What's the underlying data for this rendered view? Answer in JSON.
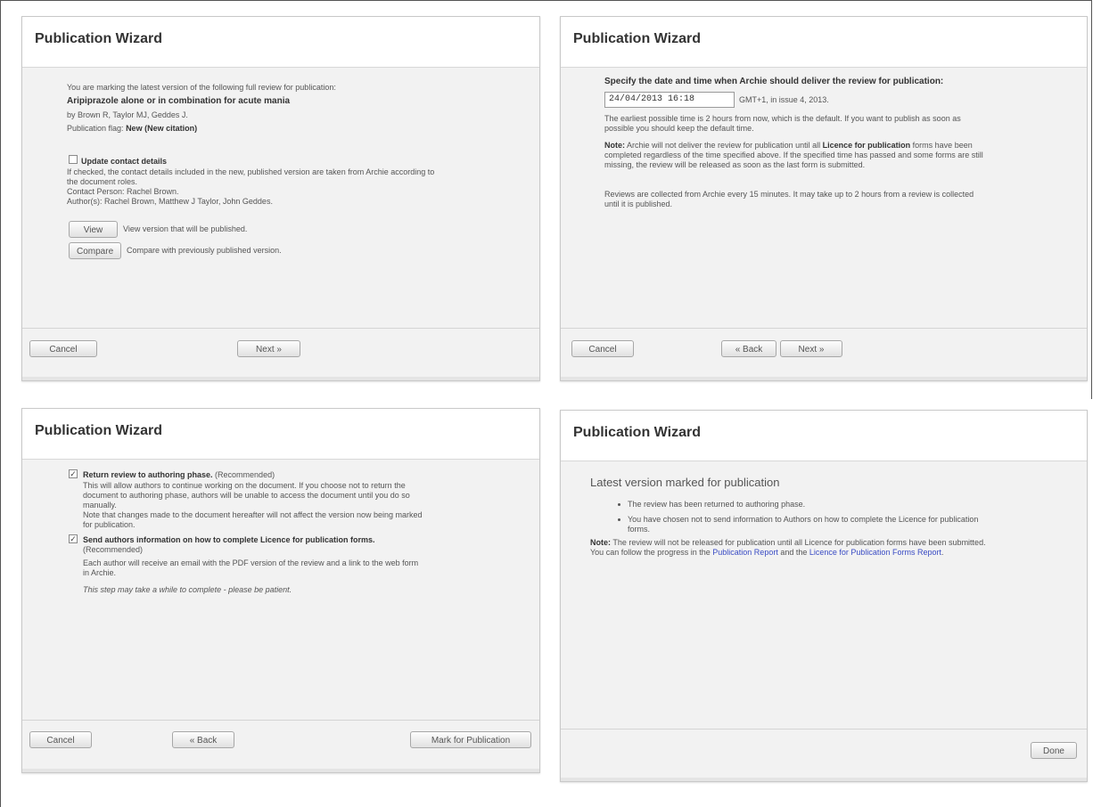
{
  "wizard_title": "Publication Wizard",
  "panel1": {
    "intro": "You are marking the latest version of the following full review for publication:",
    "review_title": "Aripiprazole alone or in combination for acute mania",
    "authors": "by Brown R, Taylor MJ, Geddes J.",
    "pub_flag_label": "Publication flag:",
    "pub_flag_value": "New (New citation)",
    "update_label": "Update contact details",
    "update_desc_1": "If checked, the contact details included in the new, published version are taken from Archie according to",
    "update_desc_2": "the document roles.",
    "contact_person": "Contact Person: Rachel Brown.",
    "authors_list": "Author(s): Rachel Brown, Matthew J Taylor, John Geddes.",
    "view_label": "View",
    "view_desc": "View version that will be published.",
    "compare_label": "Compare",
    "compare_desc": "Compare with previously published version.",
    "cancel_label": "Cancel",
    "next_label": "Next »"
  },
  "panel2": {
    "heading": "Specify the date and time when Archie should deliver the review for publication:",
    "datetime_value": "24/04/2013 16:18",
    "issue_text": "GMT+1, in issue 4, 2013.",
    "earliest_1": "The earliest possible time is 2 hours from now, which is the default. If you want to publish as soon as",
    "earliest_2": "possible you should keep the default time.",
    "note_label": "Note:",
    "note_1a": "Archie will not deliver the review for publication until all",
    "note_1b": "Licence for publication",
    "note_1c": "forms have been",
    "note_2": "completed regardless of the time specified above. If the specified time has passed and some forms are still",
    "note_3": "missing, the review will be released as soon as the last form is submitted.",
    "collected_1": "Reviews are collected from Archie every 15 minutes. It may take up to 2 hours from a review is collected",
    "collected_2": "until it is published.",
    "cancel_label": "Cancel",
    "back_label": "« Back",
    "next_label": "Next »"
  },
  "panel3": {
    "return_label": "Return review to authoring phase.",
    "recommended": "(Recommended)",
    "return_desc_1": "This will allow authors to continue working on the document. If you choose not to return the",
    "return_desc_2": "document to authoring phase, authors will be unable to access the document until you do so",
    "return_desc_3": "manually.",
    "return_desc_4": "Note that changes made to the document hereafter will not affect the version now being marked",
    "return_desc_5": "for publication.",
    "send_label": "Send authors information on how to complete Licence for publication forms.",
    "send_desc_1": "Each author will receive an email with the PDF version of the review and a link to the web form",
    "send_desc_2": "in Archie.",
    "patience": "This step may take a while to complete - please be patient.",
    "cancel_label": "Cancel",
    "back_label": "« Back",
    "mark_label": "Mark for Publication"
  },
  "panel4": {
    "heading": "Latest version marked for publication",
    "bullet_1": "The review has been returned to authoring phase.",
    "bullet_2a": "You have chosen not to send information to Authors on how to complete the Licence for publication",
    "bullet_2b": "forms.",
    "note_label": "Note:",
    "note_1": "The review will not be released for publication until all Licence for publication forms have been submitted.",
    "note_2a": "You can follow the progress in the",
    "link_report": "Publication Report",
    "note_2b": "and the",
    "link_forms": "Licence for Publication Forms Report",
    "note_2c": ".",
    "done_label": "Done"
  }
}
